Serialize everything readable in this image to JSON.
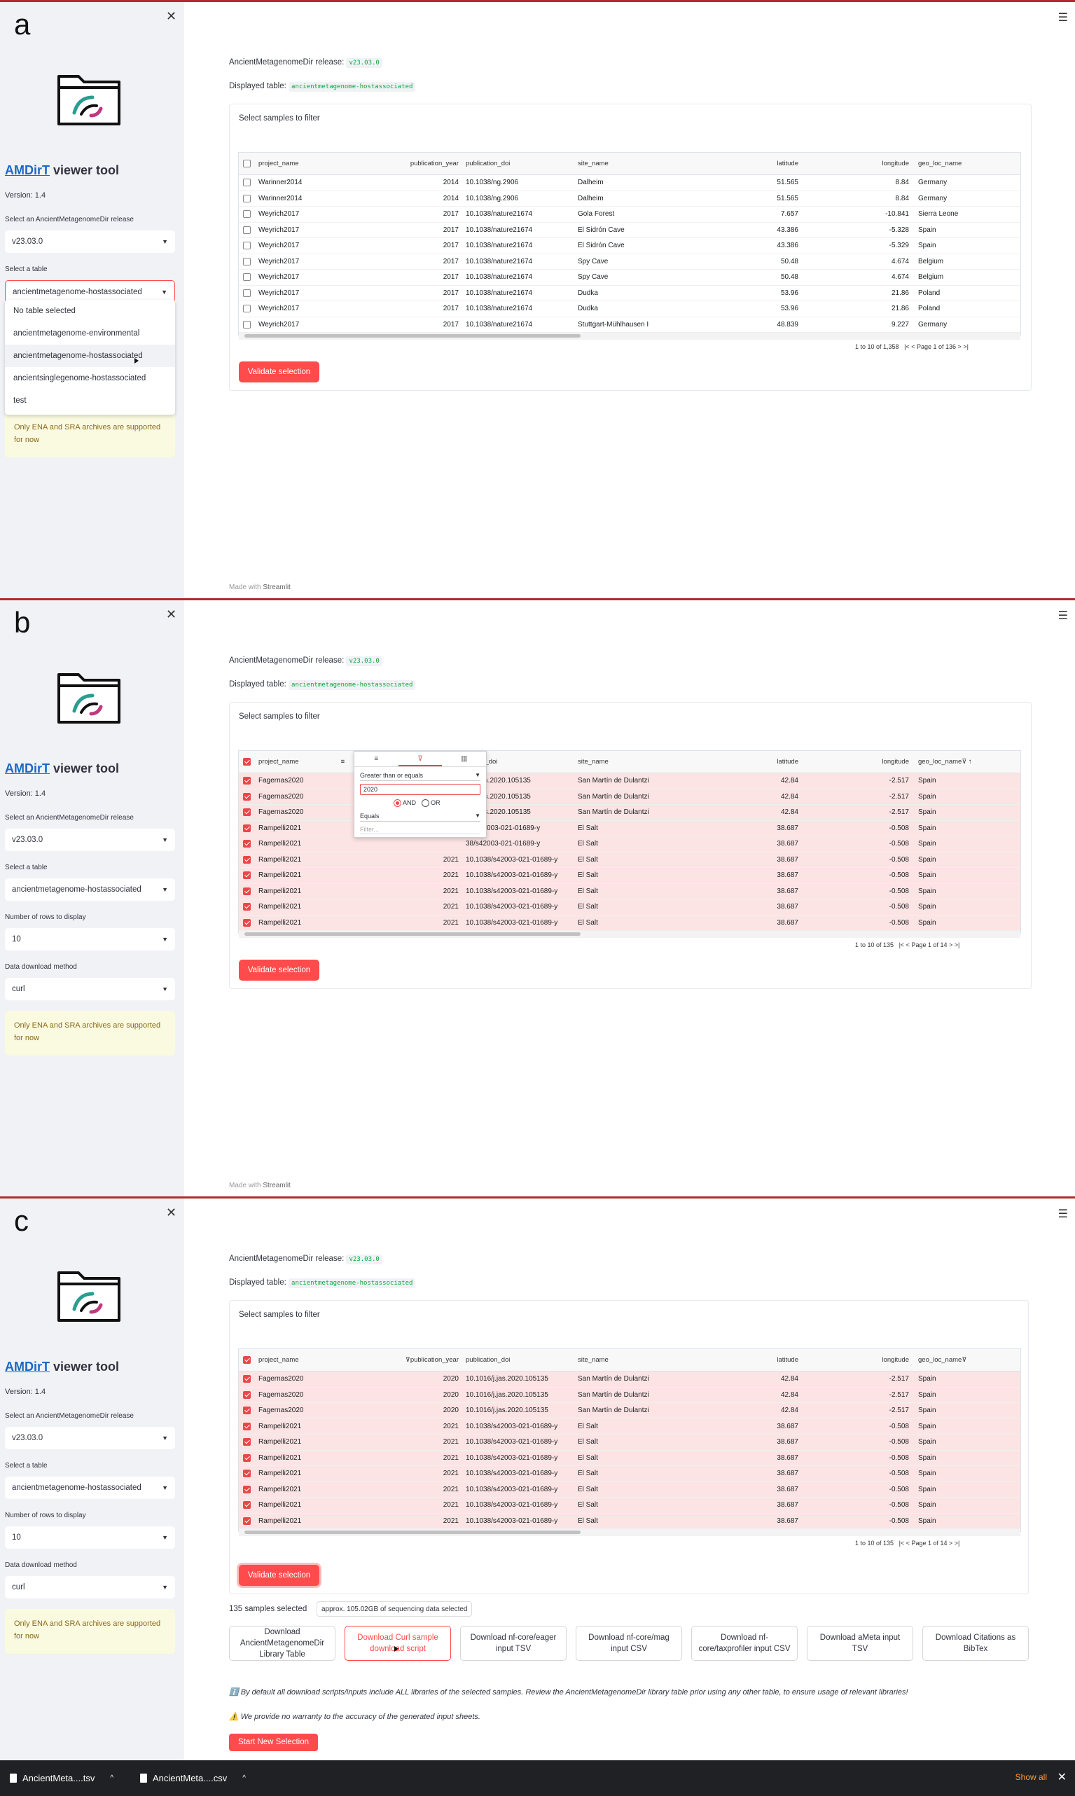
{
  "panels": {
    "a": "a",
    "b": "b",
    "c": "c"
  },
  "sidebar": {
    "title_link": "AMDirT",
    "title_rest": " viewer tool",
    "version": "Version: 1.4",
    "release_label": "Select an AncientMetagenomeDir release",
    "release_value": "v23.03.0",
    "table_label": "Select a table",
    "table_value": "ancientmetagenome-hostassociated",
    "table_options": [
      "No table selected",
      "ancientmetagenome-environmental",
      "ancientmetagenome-hostassociated",
      "ancientsinglegenome-hostassociated",
      "test"
    ],
    "rows_label": "Number of rows to display",
    "rows_value": "10",
    "download_label": "Data download method",
    "download_value": "curl",
    "warning": "Only ENA and SRA archives are supported for now",
    "close_icon": "close-icon",
    "menu_icon": "hamburger-menu-icon"
  },
  "main": {
    "release_text": "AncientMetagenomeDir release:",
    "release_code": "v23.03.0",
    "table_text": "Displayed table:",
    "table_code": "ancientmetagenome-hostassociated",
    "select_title": "Select samples to filter",
    "validate": "Validate selection",
    "made_with": "Made with",
    "streamlit": "Streamlit"
  },
  "columns": [
    "project_name",
    "publication_year",
    "publication_doi",
    "site_name",
    "latitude",
    "longitude",
    "geo_loc_name"
  ],
  "table_a": {
    "rows": [
      [
        "Warinner2014",
        "2014",
        "10.1038/ng.2906",
        "Dalheim",
        "51.565",
        "8.84",
        "Germany"
      ],
      [
        "Warinner2014",
        "2014",
        "10.1038/ng.2906",
        "Dalheim",
        "51.565",
        "8.84",
        "Germany"
      ],
      [
        "Weyrich2017",
        "2017",
        "10.1038/nature21674",
        "Gola Forest",
        "7.657",
        "-10.841",
        "Sierra Leone"
      ],
      [
        "Weyrich2017",
        "2017",
        "10.1038/nature21674",
        "El Sidrón Cave",
        "43.386",
        "-5.328",
        "Spain"
      ],
      [
        "Weyrich2017",
        "2017",
        "10.1038/nature21674",
        "El Sidrón Cave",
        "43.386",
        "-5.329",
        "Spain"
      ],
      [
        "Weyrich2017",
        "2017",
        "10.1038/nature21674",
        "Spy Cave",
        "50.48",
        "4.674",
        "Belgium"
      ],
      [
        "Weyrich2017",
        "2017",
        "10.1038/nature21674",
        "Spy Cave",
        "50.48",
        "4.674",
        "Belgium"
      ],
      [
        "Weyrich2017",
        "2017",
        "10.1038/nature21674",
        "Dudka",
        "53.96",
        "21.86",
        "Poland"
      ],
      [
        "Weyrich2017",
        "2017",
        "10.1038/nature21674",
        "Dudka",
        "53.96",
        "21.86",
        "Poland"
      ],
      [
        "Weyrich2017",
        "2017",
        "10.1038/nature21674",
        "Stuttgart-Mühlhausen I",
        "48.839",
        "9.227",
        "Germany"
      ]
    ],
    "pager_range": "1 to 10 of 1,358",
    "pager_page": "Page 1 of 136"
  },
  "table_b": {
    "rows": [
      [
        "Fagernas2020",
        "",
        "16/j.jas.2020.105135",
        "San Martín de Dulantzi",
        "42.84",
        "-2.517",
        "Spain"
      ],
      [
        "Fagernas2020",
        "",
        "16/j.jas.2020.105135",
        "San Martín de Dulantzi",
        "42.84",
        "-2.517",
        "Spain"
      ],
      [
        "Fagernas2020",
        "",
        "16/j.jas.2020.105135",
        "San Martín de Dulantzi",
        "42.84",
        "-2.517",
        "Spain"
      ],
      [
        "Rampelli2021",
        "",
        "38/s42003-021-01689-y",
        "El Salt",
        "38.687",
        "-0.508",
        "Spain"
      ],
      [
        "Rampelli2021",
        "",
        "38/s42003-021-01689-y",
        "El Salt",
        "38.687",
        "-0.508",
        "Spain"
      ],
      [
        "Rampelli2021",
        "2021",
        "10.1038/s42003-021-01689-y",
        "El Salt",
        "38.687",
        "-0.508",
        "Spain"
      ],
      [
        "Rampelli2021",
        "2021",
        "10.1038/s42003-021-01689-y",
        "El Salt",
        "38.687",
        "-0.508",
        "Spain"
      ],
      [
        "Rampelli2021",
        "2021",
        "10.1038/s42003-021-01689-y",
        "El Salt",
        "38.687",
        "-0.508",
        "Spain"
      ],
      [
        "Rampelli2021",
        "2021",
        "10.1038/s42003-021-01689-y",
        "El Salt",
        "38.687",
        "-0.508",
        "Spain"
      ],
      [
        "Rampelli2021",
        "2021",
        "10.1038/s42003-021-01689-y",
        "El Salt",
        "38.687",
        "-0.508",
        "Spain"
      ]
    ],
    "header_doi": "ication_doi",
    "pager_range": "1 to 10 of 135",
    "pager_page": "Page 1 of 14",
    "filter": {
      "condition1": "Greater than or equals",
      "value1": "2020",
      "and": "AND",
      "or": "OR",
      "condition2": "Equals",
      "placeholder": "Filter..."
    }
  },
  "table_c": {
    "rows": [
      [
        "Fagernas2020",
        "2020",
        "10.1016/j.jas.2020.105135",
        "San Martín de Dulantzi",
        "42.84",
        "-2.517",
        "Spain"
      ],
      [
        "Fagernas2020",
        "2020",
        "10.1016/j.jas.2020.105135",
        "San Martín de Dulantzi",
        "42.84",
        "-2.517",
        "Spain"
      ],
      [
        "Fagernas2020",
        "2020",
        "10.1016/j.jas.2020.105135",
        "San Martín de Dulantzi",
        "42.84",
        "-2.517",
        "Spain"
      ],
      [
        "Rampelli2021",
        "2021",
        "10.1038/s42003-021-01689-y",
        "El Salt",
        "38.687",
        "-0.508",
        "Spain"
      ],
      [
        "Rampelli2021",
        "2021",
        "10.1038/s42003-021-01689-y",
        "El Salt",
        "38.687",
        "-0.508",
        "Spain"
      ],
      [
        "Rampelli2021",
        "2021",
        "10.1038/s42003-021-01689-y",
        "El Salt",
        "38.687",
        "-0.508",
        "Spain"
      ],
      [
        "Rampelli2021",
        "2021",
        "10.1038/s42003-021-01689-y",
        "El Salt",
        "38.687",
        "-0.508",
        "Spain"
      ],
      [
        "Rampelli2021",
        "2021",
        "10.1038/s42003-021-01689-y",
        "El Salt",
        "38.687",
        "-0.508",
        "Spain"
      ],
      [
        "Rampelli2021",
        "2021",
        "10.1038/s42003-021-01689-y",
        "El Salt",
        "38.687",
        "-0.508",
        "Spain"
      ],
      [
        "Rampelli2021",
        "2021",
        "10.1038/s42003-021-01689-y",
        "El Salt",
        "38.687",
        "-0.508",
        "Spain"
      ]
    ],
    "pager_range": "1 to 10 of 135",
    "pager_page": "Page 1 of 14"
  },
  "results": {
    "count": "135 samples selected",
    "size": "approx. 105.02GB of sequencing data selected",
    "buttons": [
      "Download AncientMetagenomeDir Library Table",
      "Download Curl sample download script",
      "Download nf-core/eager input TSV",
      "Download nf-core/mag input CSV",
      "Download nf-core/taxprofiler input CSV",
      "Download aMeta input TSV",
      "Download Citations as BibTex"
    ],
    "info": "ℹ️ By default all download scripts/inputs include ALL libraries of the selected samples. Review the AncientMetagenomeDir library table prior using any other table, to ensure usage of relevant libraries!",
    "warning": "⚠️ We provide no warranty to the accuracy of the generated input sheets.",
    "start_new": "Start New Selection"
  },
  "taskbar": {
    "file1": "AncientMeta....tsv",
    "file2": "AncientMeta....csv",
    "show_all": "Show all",
    "close": "✕"
  },
  "colors": {
    "accent": "#ff4b4b",
    "sidebar": "#f0f2f6",
    "code": "#09ab3b",
    "link": "#1a68c7",
    "taskbar": "#202124"
  }
}
